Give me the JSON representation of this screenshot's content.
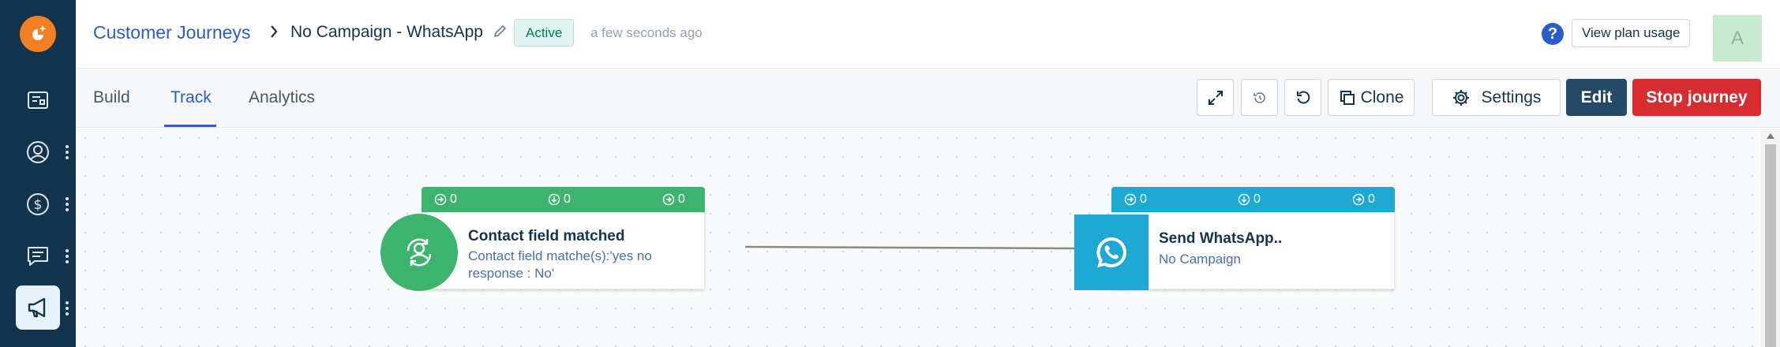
{
  "header": {
    "breadcrumb": "Customer Journeys",
    "title": "No Campaign - WhatsApp",
    "status": "Active",
    "updated": "a few seconds ago",
    "help": "?",
    "plan_usage": "View plan usage",
    "avatar_initial": "A"
  },
  "tabs": [
    {
      "label": "Build",
      "active": false
    },
    {
      "label": "Track",
      "active": true
    },
    {
      "label": "Analytics",
      "active": false
    }
  ],
  "toolbar": {
    "clone": "Clone",
    "settings": "Settings",
    "edit": "Edit",
    "stop": "Stop journey"
  },
  "nodes": [
    {
      "title": "Contact field matched",
      "subtitle_line1": "Contact field matche(s):'yes no",
      "subtitle_line2": "response : No'",
      "stats": [
        "0",
        "0",
        "0"
      ],
      "color": "#3db46d"
    },
    {
      "title": "Send WhatsApp..",
      "subtitle_line1": "No Campaign",
      "stats": [
        "0",
        "0",
        "0"
      ],
      "color": "#1ea8d4"
    }
  ],
  "colors": {
    "sidebar": "#12344d",
    "accent": "#2c5cc5",
    "brand": "#f08021",
    "edit": "#264966",
    "stop": "#d72d30"
  }
}
